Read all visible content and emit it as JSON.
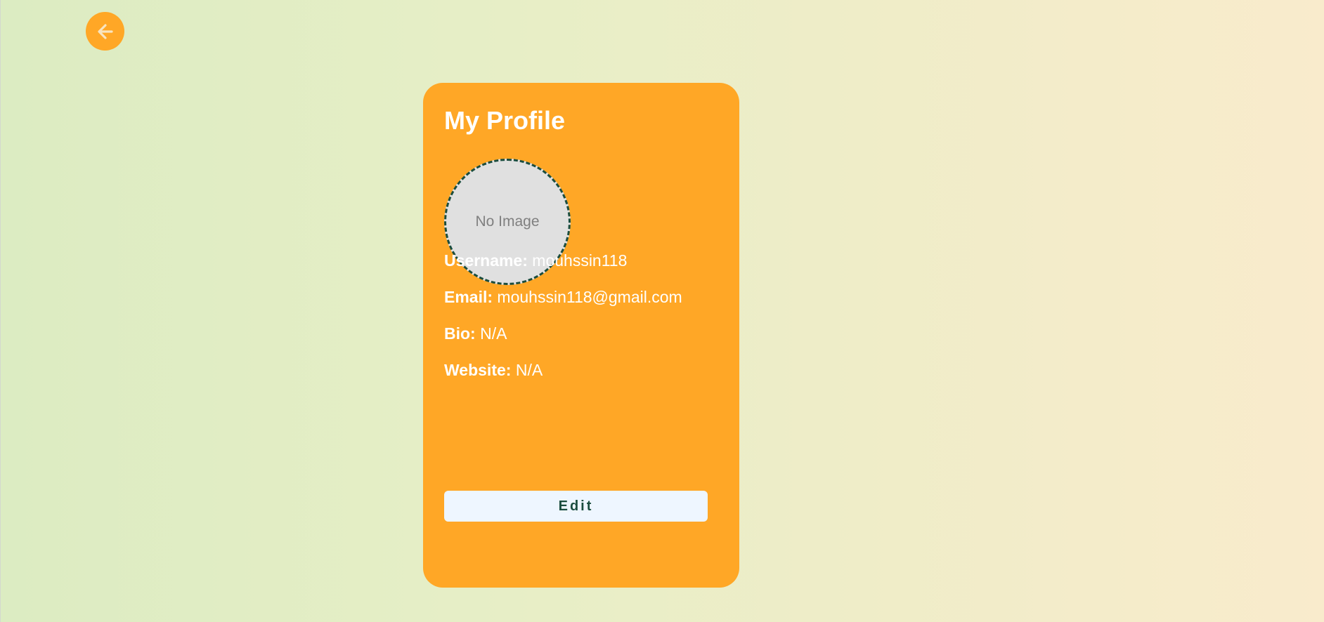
{
  "header": {
    "back_icon": "arrow-left-icon"
  },
  "profile": {
    "title": "My Profile",
    "avatar_placeholder": "No Image",
    "fields": [
      {
        "label": "Username:",
        "value": "mouhssin118"
      },
      {
        "label": "Email:",
        "value": "mouhssin118@gmail.com"
      },
      {
        "label": "Bio:",
        "value": "N/A"
      },
      {
        "label": "Website:",
        "value": "N/A"
      }
    ],
    "edit_label": "Edit"
  },
  "colors": {
    "accent": "#ffa726",
    "button_bg": "#eef6ff",
    "button_text": "#1b4d3e",
    "avatar_bg": "#e0e0e0"
  }
}
